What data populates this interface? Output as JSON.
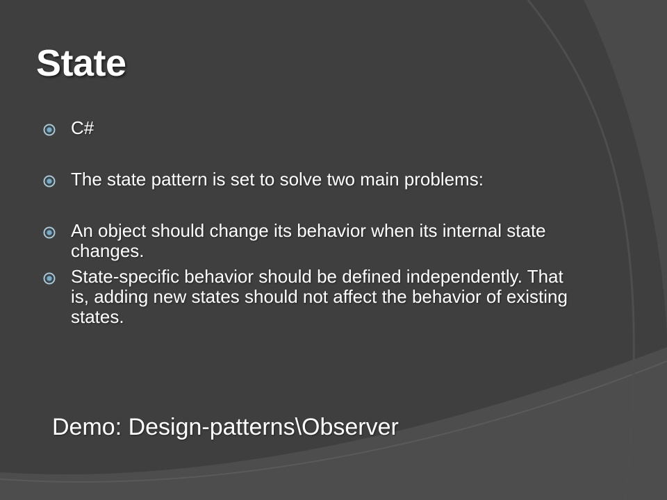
{
  "slide": {
    "title": "State",
    "bullets": [
      {
        "text": "C#"
      },
      {
        "text": "The state pattern is set to solve two main problems:"
      },
      {
        "text": "An object should change its behavior when its internal state changes."
      },
      {
        "text": "State-specific behavior should be defined independently. That is, adding new states should not affect the behavior of existing states."
      }
    ],
    "demo_text": "Demo: Design-patterns\\Observer"
  },
  "colors": {
    "background": "#3a3a3a",
    "arc_light": "#555555",
    "text": "#ffffff",
    "bullet_ring": "#a9c7d6",
    "bullet_fill": "#2f5f7f"
  },
  "icons": {
    "bullet": "circled-dot-icon"
  }
}
